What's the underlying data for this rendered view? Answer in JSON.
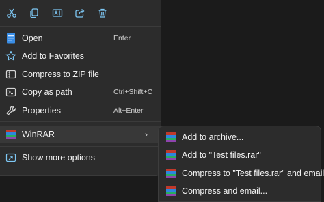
{
  "toolbar": {
    "items": [
      {
        "name": "cut-button",
        "icon": "scissors-icon"
      },
      {
        "name": "copy-button",
        "icon": "copy-icon"
      },
      {
        "name": "rename-button",
        "icon": "rename-icon"
      },
      {
        "name": "share-button",
        "icon": "share-icon"
      },
      {
        "name": "delete-button",
        "icon": "trash-icon"
      }
    ]
  },
  "menu": {
    "open": {
      "label": "Open",
      "shortcut": "Enter"
    },
    "favorites": {
      "label": "Add to Favorites"
    },
    "compress_zip": {
      "label": "Compress to ZIP file"
    },
    "copy_path": {
      "label": "Copy as path",
      "shortcut": "Ctrl+Shift+C"
    },
    "properties": {
      "label": "Properties",
      "shortcut": "Alt+Enter"
    },
    "winrar": {
      "label": "WinRAR"
    },
    "more": {
      "label": "Show more options"
    }
  },
  "submenu": {
    "items": [
      {
        "label": "Add to archive..."
      },
      {
        "label": "Add to \"Test files.rar\""
      },
      {
        "label": "Compress to \"Test files.rar\" and email"
      },
      {
        "label": "Compress and email..."
      }
    ]
  },
  "colors": {
    "accent": "#4cc2ff",
    "menu_bg": "#2c2c2c",
    "highlight": "#383838"
  }
}
